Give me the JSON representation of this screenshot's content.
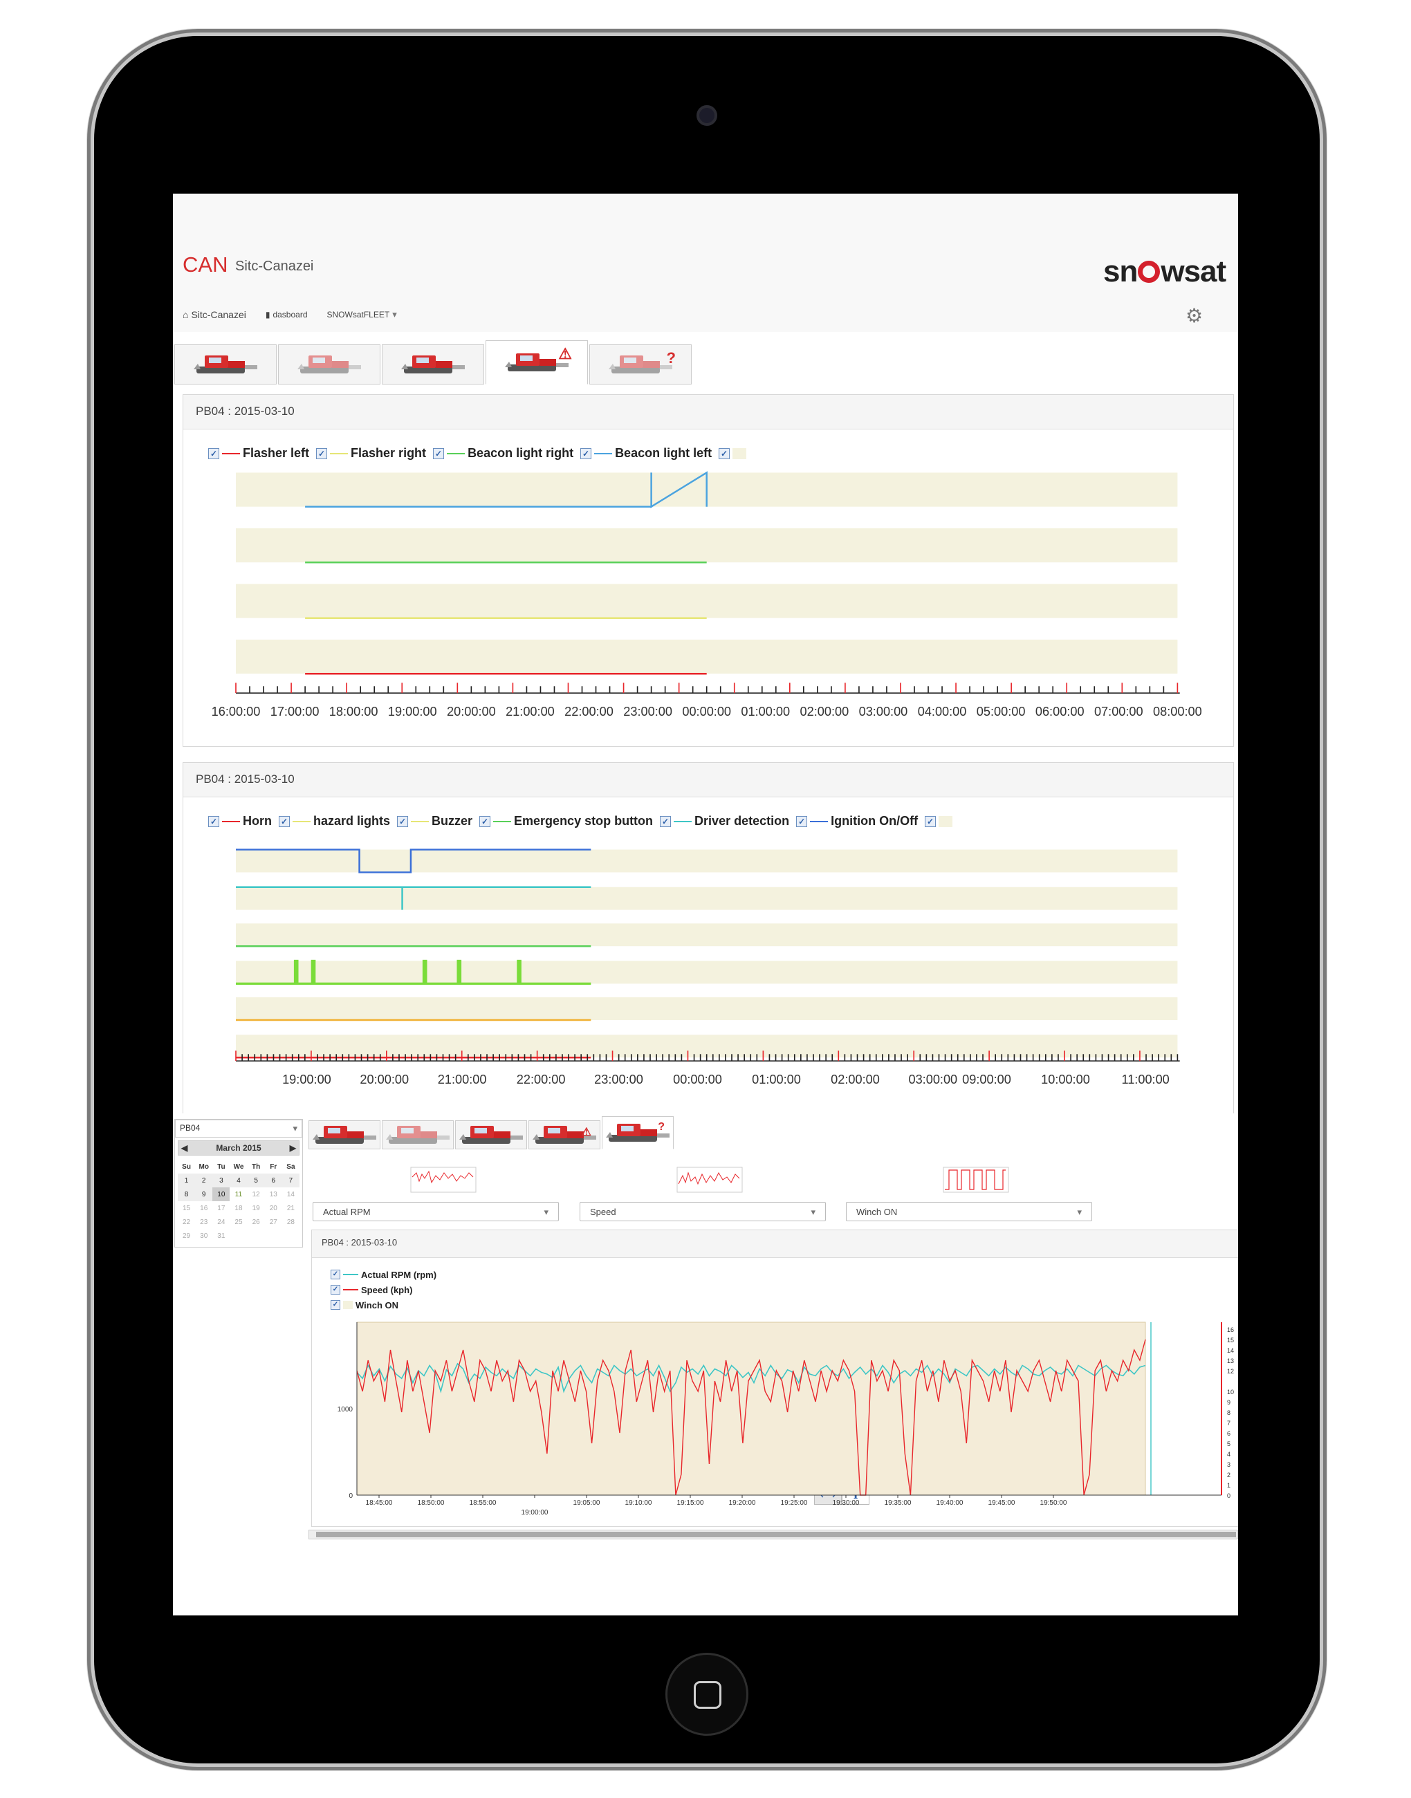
{
  "app": {
    "title": "CAN",
    "subtitle": "Sitc-Canazei",
    "brand": "snowsat"
  },
  "nav": {
    "home": "Sitc-Canazei",
    "dashboard": "dasboard",
    "fleet": "SNOWsatFLEET"
  },
  "colors": {
    "accent": "#d62d2d",
    "band": "#f4f2de",
    "red": "#e8262b",
    "cyan": "#3ec6c6",
    "blue": "#3a6fd8",
    "green": "#58d058",
    "yellow": "#e6e676"
  },
  "tabs": [
    {
      "icon": "snowcat-icon",
      "mark": ""
    },
    {
      "icon": "snowcat-icon",
      "mark": ""
    },
    {
      "icon": "snowcat-icon",
      "mark": ""
    },
    {
      "icon": "snowcat-warning-icon",
      "mark": "⚠"
    },
    {
      "icon": "snowcat-unknown-icon",
      "mark": "?"
    }
  ],
  "panel1": {
    "header": "PB04 : 2015-03-10",
    "legend": [
      "Flasher left",
      "Flasher right",
      "Beacon light right",
      "Beacon light left"
    ]
  },
  "panel2": {
    "header": "PB04 : 2015-03-10",
    "legend": [
      "Horn",
      "hazard lights",
      "Buzzer",
      "Emergency stop button",
      "Driver detection",
      "Ignition On/Off"
    ]
  },
  "part2": {
    "calendar": {
      "vehicle": "PB04",
      "month": "March 2015",
      "weekdays": [
        "Su",
        "Mo",
        "Tu",
        "We",
        "Th",
        "Fr",
        "Sa"
      ],
      "days": [
        "1",
        "2",
        "3",
        "4",
        "5",
        "6",
        "7",
        "8",
        "9",
        "10",
        "11",
        "12",
        "13",
        "14",
        "15",
        "16",
        "17",
        "18",
        "19",
        "20",
        "21",
        "22",
        "23",
        "24",
        "25",
        "26",
        "27",
        "28",
        "29",
        "30",
        "31"
      ]
    },
    "selects": [
      "Actual RPM",
      "Speed",
      "Winch ON"
    ],
    "panel_header": "PB04 : 2015-03-10",
    "legend": [
      "Actual RPM (rpm)",
      "Speed (kph)",
      "Winch ON"
    ]
  },
  "chart_data": [
    {
      "type": "line",
      "title": "PB04 : 2015-03-10",
      "series": [
        {
          "name": "Beacon light left",
          "x": [
            "17:15:00",
            "20:00:00",
            "23:30:00",
            "00:30:00"
          ],
          "y": [
            0,
            0,
            1,
            0
          ]
        },
        {
          "name": "Beacon light right",
          "x": [
            "17:15:00",
            "00:30:00"
          ],
          "y": [
            0,
            0
          ]
        },
        {
          "name": "Flasher right",
          "x": [
            "17:15:00",
            "00:30:00"
          ],
          "y": [
            0,
            0
          ]
        },
        {
          "name": "Flasher left",
          "x": [
            "17:15:00",
            "00:30:00"
          ],
          "y": [
            0,
            0
          ]
        }
      ],
      "x_ticks": [
        "16:00:00",
        "17:00:00",
        "18:00:00",
        "19:00:00",
        "20:00:00",
        "21:00:00",
        "22:00:00",
        "23:00:00",
        "00:00:00",
        "01:00:00",
        "02:00:00",
        "03:00:00",
        "04:00:00",
        "05:00:00",
        "06:00:00",
        "07:00:00",
        "08:00:00"
      ]
    },
    {
      "type": "line",
      "title": "PB04 : 2015-03-10",
      "series": [
        {
          "name": "Ignition On/Off",
          "x": [
            "18:30:00",
            "20:15:00",
            "21:15:00",
            "00:45:00"
          ],
          "y": [
            1,
            0,
            1,
            1
          ]
        },
        {
          "name": "Driver detection",
          "x": [
            "18:30:00",
            "21:05:00",
            "00:45:00"
          ],
          "y": [
            0,
            1,
            0
          ]
        },
        {
          "name": "Emergency stop button",
          "x": [
            "18:30:00",
            "00:45:00"
          ],
          "y": [
            0,
            0
          ]
        },
        {
          "name": "Buzzer",
          "x": [
            "19:00:00",
            "19:20:00",
            "21:30:00",
            "22:10:00",
            "23:20:00"
          ],
          "y": [
            1,
            1,
            1,
            1,
            1
          ]
        },
        {
          "name": "hazard lights",
          "x": [
            "18:30:00",
            "00:45:00"
          ],
          "y": [
            0,
            0
          ]
        },
        {
          "name": "Horn",
          "x": [
            "18:30:00",
            "00:45:00"
          ],
          "y": [
            0,
            0
          ]
        }
      ],
      "x_ticks": [
        "19:00:00",
        "20:00:00",
        "21:00:00",
        "22:00:00",
        "23:00:00",
        "00:00:00",
        "01:00:00",
        "02:00:00",
        "03:00:00",
        "09:00:00",
        "10:00:00",
        "11:00:00"
      ]
    },
    {
      "type": "line",
      "title": "PB04 : 2015-03-10",
      "x_ticks": [
        "18:45:00",
        "18:50:00",
        "18:55:00",
        "19:00:00",
        "19:05:00",
        "19:10:00",
        "19:15:00",
        "19:20:00",
        "19:25:00",
        "19:30:00",
        "19:35:00",
        "19:40:00",
        "19:45:00",
        "19:50:00"
      ],
      "y_left_ticks": [
        "0",
        "1000"
      ],
      "y_right_ticks": [
        "0",
        "1",
        "2",
        "3",
        "4",
        "5",
        "6",
        "7",
        "8",
        "9",
        "10",
        "12",
        "13",
        "14",
        "15",
        "16"
      ],
      "series": [
        {
          "name": "Actual RPM (rpm)",
          "values": [
            1420,
            1350,
            1500,
            1380,
            1460,
            1320,
            1490,
            1400,
            1350,
            1470,
            1300,
            1440,
            1380,
            1500,
            1410,
            1200,
            1450,
            1380,
            1520,
            1460,
            1300,
            1400,
            1350,
            1480,
            1420,
            1380,
            1460,
            1400,
            1350,
            1500,
            1440,
            1380,
            1460,
            1420,
            1400,
            1360,
            1480,
            1200,
            1350,
            1440,
            1500,
            1380,
            1300,
            1460,
            1420,
            1380,
            1500,
            1440,
            1400,
            1460,
            1380,
            1420,
            1460,
            1380,
            1500,
            1360,
            1200,
            1300,
            1480,
            1420,
            1460,
            1400,
            1500,
            1380,
            1460,
            1430,
            1380,
            1500,
            1440,
            1360,
            1420,
            1300,
            1460,
            1380,
            1500,
            1400,
            1350,
            1450,
            1420,
            1300,
            1480,
            1400,
            1380,
            1460,
            1500,
            1420,
            1380,
            1460,
            1350,
            1420,
            1480,
            1400,
            1460,
            1380,
            1500,
            1420,
            1300,
            1400,
            1440,
            1380,
            1460,
            1420,
            1500,
            1380,
            1460,
            1400,
            1300,
            1460,
            1420,
            1380,
            1480,
            1500,
            1440,
            1380,
            1460,
            1400,
            1480,
            1420,
            1380,
            1500,
            1460,
            1400,
            1380,
            1440,
            1480,
            1420,
            1400,
            1460,
            1380,
            1500,
            1460,
            1420,
            1380,
            1460,
            1500,
            1440,
            1400,
            1380,
            1460,
            1400,
            1480,
            1500
          ]
        },
        {
          "name": "Speed (kph)",
          "values": [
            12,
            10,
            13,
            11,
            12,
            9,
            14,
            11,
            8,
            13,
            10,
            12,
            9,
            6,
            12,
            11,
            13,
            10,
            12,
            14,
            11,
            9,
            13,
            12,
            10,
            13,
            11,
            12,
            9,
            13,
            12,
            10,
            11,
            8,
            4,
            12,
            10,
            13,
            11,
            9,
            12,
            10,
            5,
            11,
            13,
            12,
            10,
            6,
            12,
            14,
            9,
            11,
            13,
            8,
            12,
            10,
            12,
            0,
            2,
            13,
            11,
            10,
            12,
            3,
            11,
            9,
            13,
            10,
            12,
            5,
            11,
            12,
            13,
            10,
            9,
            12,
            11,
            8,
            12,
            10,
            13,
            11,
            9,
            12,
            10,
            12,
            11,
            13,
            12,
            10,
            0,
            0,
            13,
            11,
            12,
            10,
            13,
            12,
            4,
            0,
            11,
            13,
            10,
            12,
            9,
            13,
            11,
            12,
            10,
            5,
            13,
            12,
            11,
            9,
            12,
            10,
            13,
            8,
            12,
            11,
            10,
            12,
            13,
            11,
            9,
            12,
            10,
            13,
            12,
            11,
            0,
            2,
            12,
            13,
            10,
            12,
            11,
            13,
            12,
            14,
            13,
            15
          ]
        },
        {
          "name": "Winch ON",
          "values": [
            1,
            1,
            1,
            1,
            1,
            1,
            1,
            1,
            1,
            1
          ]
        }
      ]
    }
  ]
}
